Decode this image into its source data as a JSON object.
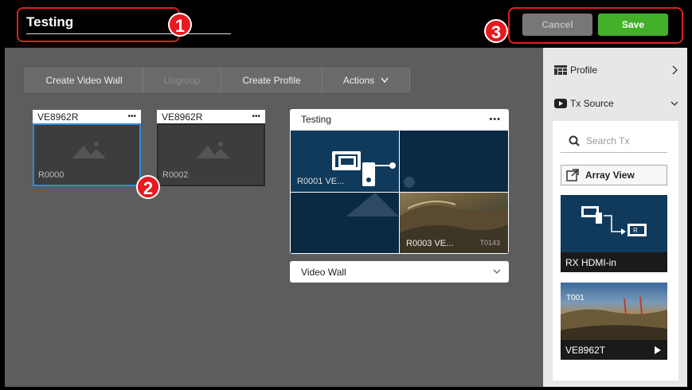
{
  "header": {
    "title": "Testing",
    "cancel_label": "Cancel",
    "save_label": "Save"
  },
  "badges": [
    "1",
    "2",
    "3"
  ],
  "toolbar": {
    "create_video_wall": "Create Video Wall",
    "ungroup": "Ungroup",
    "create_profile": "Create Profile",
    "actions": "Actions"
  },
  "tiles": [
    {
      "device": "VE8962R",
      "menu": "•••",
      "label": "R0000"
    },
    {
      "device": "VE8962R",
      "menu": "•••",
      "label": "R0002"
    }
  ],
  "wall": {
    "title": "Testing",
    "menu": "•••",
    "cell_1_label": "R0001 VE...",
    "cell_4_label": "R0003 VE...",
    "cell_4_tag": "T0143"
  },
  "layout_select": {
    "value": "Video Wall"
  },
  "right_panel": {
    "profile_label": "Profile",
    "tx_source_label": "Tx Source",
    "search_placeholder": "Search Tx",
    "array_view_label": "Array View",
    "sources": [
      {
        "name": "RX HDMI-in"
      },
      {
        "name": "VE8962T",
        "tag": "T001"
      }
    ]
  },
  "colors": {
    "save_green": "#43b02a",
    "highlight_red": "#e02020",
    "selection_blue": "#2b8be0",
    "tile_navy": "#0f3a5c"
  }
}
